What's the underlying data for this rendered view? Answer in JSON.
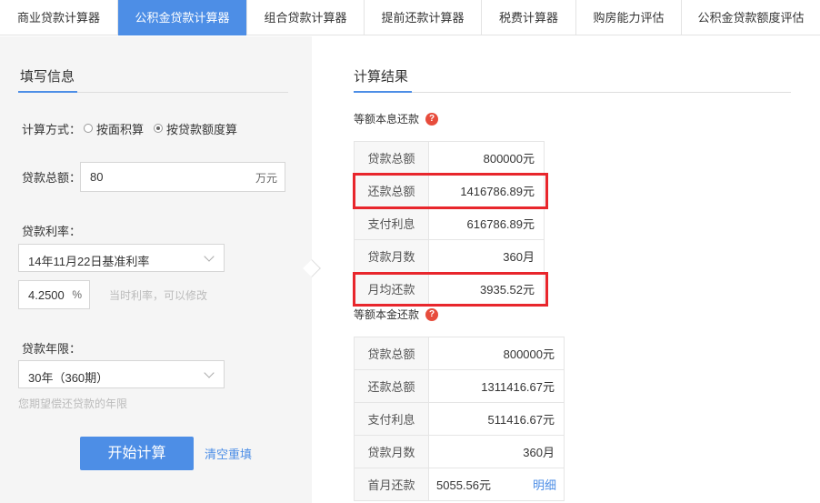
{
  "tabs": [
    {
      "label": "商业贷款计算器",
      "active": false
    },
    {
      "label": "公积金贷款计算器",
      "active": true
    },
    {
      "label": "组合贷款计算器",
      "active": false
    },
    {
      "label": "提前还款计算器",
      "active": false
    },
    {
      "label": "税费计算器",
      "active": false
    },
    {
      "label": "购房能力评估",
      "active": false
    },
    {
      "label": "公积金贷款额度评估",
      "active": false
    }
  ],
  "form": {
    "title": "填写信息",
    "calc_method_label": "计算方式：",
    "calc_method_options": [
      "按面积算",
      "按贷款额度算"
    ],
    "calc_method_selected": "按贷款额度算",
    "loan_total_label": "贷款总额：",
    "loan_total_value": "80",
    "loan_total_unit": "万元",
    "rate_label": "贷款利率：",
    "rate_select_value": "14年11月22日基准利率",
    "rate_value": "4.2500",
    "rate_unit": "%",
    "rate_hint": "当时利率，可以修改",
    "term_label": "贷款年限：",
    "term_select_value": "30年（360期）",
    "term_hint": "您期望偿还贷款的年限",
    "submit_label": "开始计算",
    "reset_label": "清空重填"
  },
  "results": {
    "title": "计算结果",
    "equal_installment": {
      "heading": "等额本息还款",
      "rows": [
        {
          "key": "贷款总额",
          "value": "800000元"
        },
        {
          "key": "还款总额",
          "value": "1416786.89元"
        },
        {
          "key": "支付利息",
          "value": "616786.89元"
        },
        {
          "key": "贷款月数",
          "value": "360月"
        },
        {
          "key": "月均还款",
          "value": "3935.52元"
        }
      ]
    },
    "equal_principal": {
      "heading": "等额本金还款",
      "rows": [
        {
          "key": "贷款总额",
          "value": "800000元"
        },
        {
          "key": "还款总额",
          "value": "1311416.67元"
        },
        {
          "key": "支付利息",
          "value": "511416.67元"
        },
        {
          "key": "贷款月数",
          "value": "360月"
        }
      ],
      "first_month_key": "首月还款",
      "first_month_value": "5055.56元",
      "detail_link": "明细"
    }
  },
  "colors": {
    "accent": "#4d8ee6",
    "highlight": "#e8262c",
    "help_icon": "#e74c3c"
  }
}
